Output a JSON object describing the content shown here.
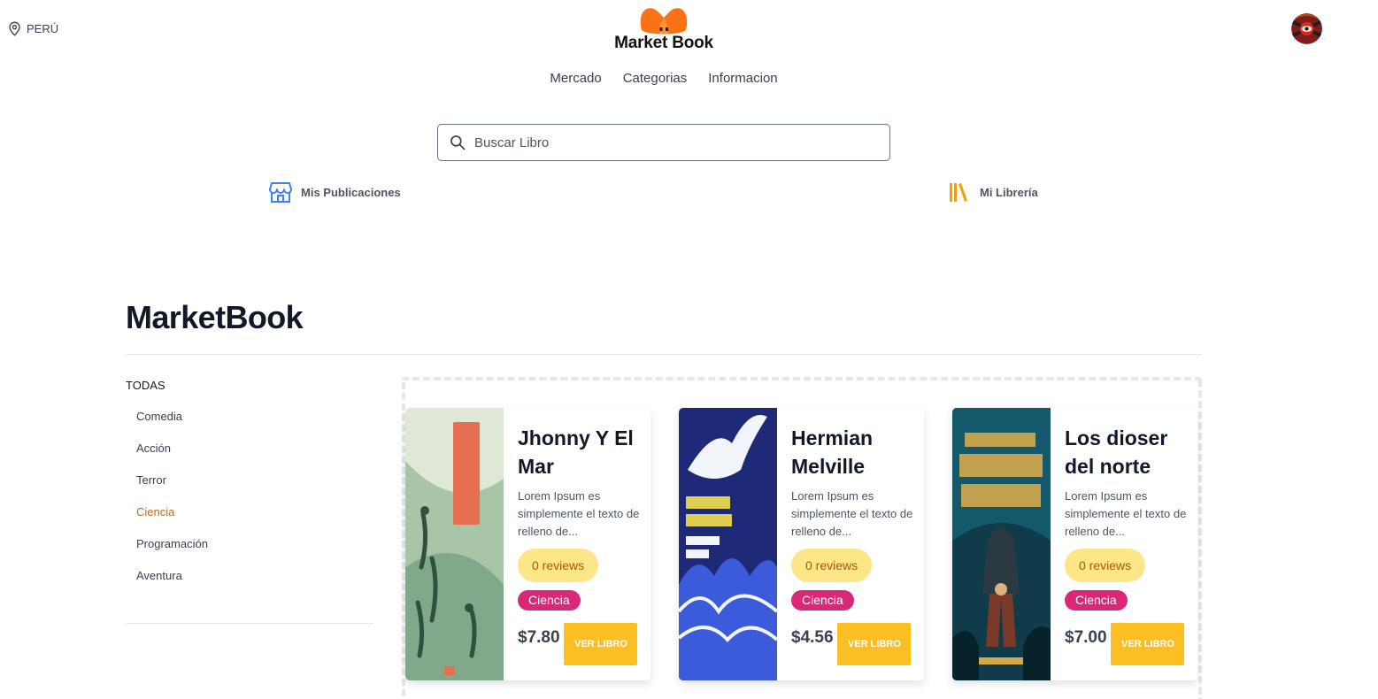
{
  "header": {
    "location": "PERÚ",
    "brand": "Market Book",
    "nav": [
      "Mercado",
      "Categorias",
      "Informacion"
    ],
    "search_placeholder": "Buscar Libro",
    "quick_links": {
      "publicaciones": "Mis Publicaciones",
      "libreria": "Mi Librería"
    }
  },
  "main": {
    "title": "MarketBook"
  },
  "sidebar": {
    "all_label": "TODAS",
    "categories": [
      "Comedia",
      "Acción",
      "Terror",
      "Ciencia",
      "Programación",
      "Aventura"
    ],
    "active_category": "Ciencia"
  },
  "books": [
    {
      "title": "Jhonny Y El Mar",
      "desc": "Lorem Ipsum es simplemente el texto de relleno de...",
      "reviews": "0 reviews",
      "tag": "Ciencia",
      "price": "$7.80",
      "button": "VER LIBRO"
    },
    {
      "title": "Hermian Melville",
      "desc": "Lorem Ipsum es simplemente el texto de relleno de...",
      "reviews": "0 reviews",
      "tag": "Ciencia",
      "price": "$4.56",
      "button": "VER LIBRO"
    },
    {
      "title": "Los dioser del norte",
      "desc": "Lorem Ipsum es simplemente el texto de relleno de...",
      "reviews": "0 reviews",
      "tag": "Ciencia",
      "price": "$7.00",
      "button": "VER LIBRO"
    }
  ],
  "colors": {
    "accent": "#fbbf24",
    "tag": "#db2777",
    "reviews_bg": "#fde68a",
    "active_category": "#c2691a",
    "logo": "#f97316"
  }
}
